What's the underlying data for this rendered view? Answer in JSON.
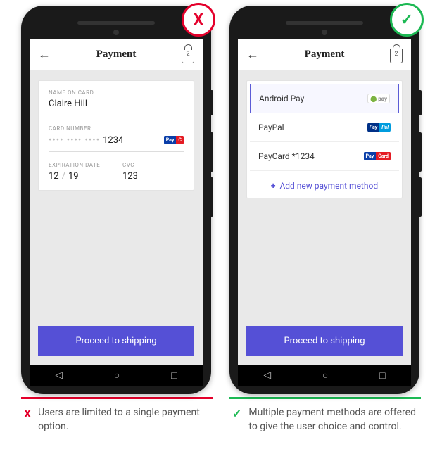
{
  "left": {
    "header": {
      "title": "Payment",
      "bag_count": "2"
    },
    "form": {
      "name_label": "NAME ON CARD",
      "name_value": "Claire Hill",
      "number_label": "CARD NUMBER",
      "number_mask": "•••• •••• ••••",
      "number_last4": "1234",
      "exp_label": "EXPIRATION DATE",
      "exp_mm": "12",
      "exp_yy": "19",
      "cvc_label": "CVC",
      "cvc_value": "123"
    },
    "cta": "Proceed to shipping",
    "caption": "Users are limited to a single payment option."
  },
  "right": {
    "header": {
      "title": "Payment",
      "bag_count": "2"
    },
    "options": [
      {
        "label": "Android Pay",
        "logo": "android-pay",
        "selected": true
      },
      {
        "label": "PayPal",
        "logo": "paypal",
        "selected": false
      },
      {
        "label": "PayCard *1234",
        "logo": "paycard",
        "selected": false
      }
    ],
    "add_new": "Add new payment method",
    "cta": "Proceed to shipping",
    "caption": "Multiple payment methods are offered to give the user choice and control."
  },
  "badges": {
    "bad": "X",
    "good": "✓"
  }
}
